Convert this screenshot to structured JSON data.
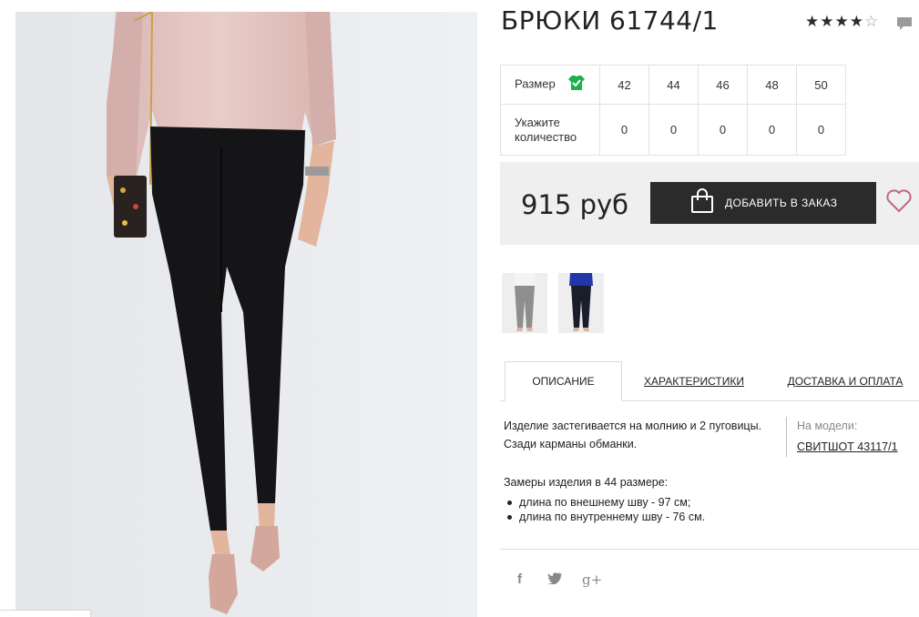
{
  "product": {
    "title": "БРЮКИ 61744/1",
    "rating_filled": "★★★★",
    "rating_empty": "☆"
  },
  "size_table": {
    "size_label": "Размер",
    "sizes": [
      "42",
      "44",
      "46",
      "48",
      "50"
    ],
    "qty_label": "Укажите количество",
    "quantities": [
      "0",
      "0",
      "0",
      "0",
      "0"
    ]
  },
  "purchase": {
    "price": "915 руб",
    "add_button": "ДОБАВИТЬ В ЗАКАЗ"
  },
  "tabs": [
    "ОПИСАНИЕ",
    "ХАРАКТЕРИСТИКИ",
    "ДОСТАВКА И ОПЛАТА"
  ],
  "description": {
    "text": "Изделие застегивается на молнию и 2 пуговицы. Сзади карманы обманки.",
    "on_model_label": "На модели:",
    "on_model_link": "СВИТШОТ 43117/1",
    "measures_title": "Замеры изделия в 44 размере:",
    "measures": [
      "длина по внешнему шву - 97 см;",
      "длина по внутреннему шву - 76 см."
    ]
  },
  "social": {
    "facebook": "f",
    "twitter": "t",
    "google_plus": "g+"
  },
  "colors": {
    "button_bg": "#2b2b2b",
    "price_box_bg": "#efefef",
    "heart": "#c2667e",
    "check_badge": "#1bb24a"
  },
  "icons": {
    "rating": "star-icon",
    "comment": "comment-icon",
    "size_check": "shirt-check-icon",
    "cart": "shopping-bag-icon",
    "wishlist": "heart-icon"
  }
}
